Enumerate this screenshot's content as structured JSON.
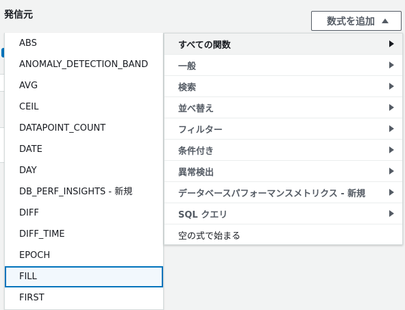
{
  "header": {
    "source_label": "発信元",
    "add_math_label": "数式を追加"
  },
  "function_list": [
    "ABS",
    "ANOMALY_DETECTION_BAND",
    "AVG",
    "CEIL",
    "DATAPOINT_COUNT",
    "DATE",
    "DAY",
    "DB_PERF_INSIGHTS - 新規",
    "DIFF",
    "DIFF_TIME",
    "EPOCH",
    "FILL",
    "FIRST"
  ],
  "highlighted_function": "FILL",
  "categories": [
    {
      "label": "すべての関数",
      "has_submenu": true,
      "active": true
    },
    {
      "label": "一般",
      "has_submenu": true
    },
    {
      "label": "検索",
      "has_submenu": true
    },
    {
      "label": "並べ替え",
      "has_submenu": true
    },
    {
      "label": "フィルター",
      "has_submenu": true
    },
    {
      "label": "条件付き",
      "has_submenu": true
    },
    {
      "label": "異常検出",
      "has_submenu": true
    },
    {
      "label": "データベースパフォーマンスメトリクス - 新規",
      "has_submenu": true
    },
    {
      "label": "SQL クエリ",
      "has_submenu": true
    },
    {
      "label": "空の式で始まる",
      "has_submenu": false
    }
  ],
  "colors": {
    "focus_blue": "#0073bb",
    "text_primary": "#16191f",
    "text_secondary": "#545b64"
  }
}
